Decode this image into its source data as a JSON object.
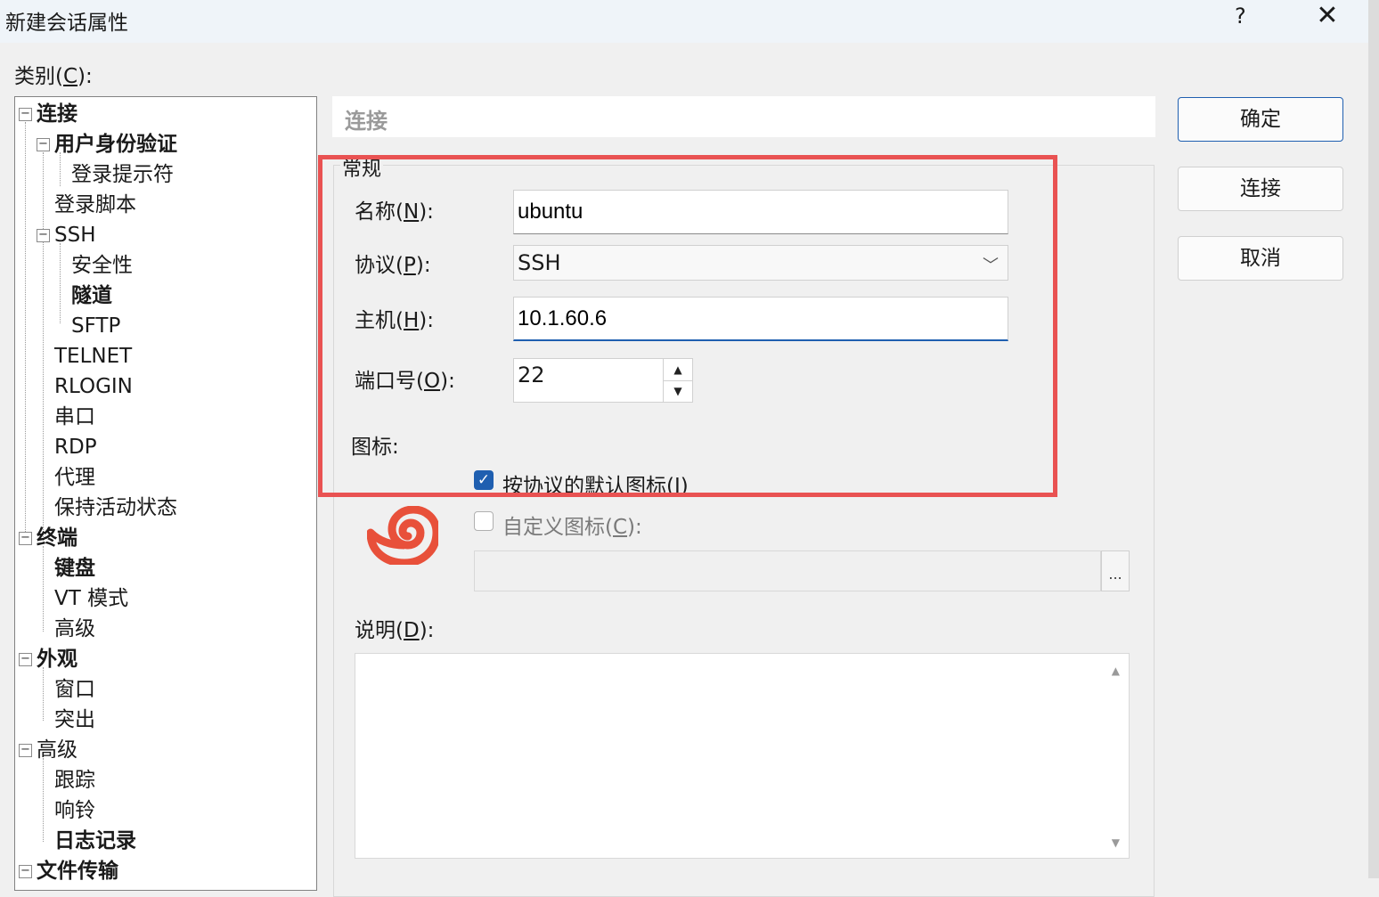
{
  "window": {
    "title": "新建会话属性",
    "help_label": "?",
    "close_label": "✕"
  },
  "category": {
    "label_prefix": "类别(",
    "label_hotkey": "C",
    "label_suffix": "):"
  },
  "tree": {
    "items": [
      {
        "label": "连接",
        "bold": true
      },
      {
        "label": "用户身份验证",
        "bold": true
      },
      {
        "label": "登录提示符",
        "bold": false
      },
      {
        "label": "登录脚本",
        "bold": false
      },
      {
        "label": "SSH",
        "bold": false
      },
      {
        "label": "安全性",
        "bold": false
      },
      {
        "label": "隧道",
        "bold": true
      },
      {
        "label": "SFTP",
        "bold": false
      },
      {
        "label": "TELNET",
        "bold": false
      },
      {
        "label": "RLOGIN",
        "bold": false
      },
      {
        "label": "串口",
        "bold": false
      },
      {
        "label": "RDP",
        "bold": false
      },
      {
        "label": "代理",
        "bold": false
      },
      {
        "label": "保持活动状态",
        "bold": false
      },
      {
        "label": "终端",
        "bold": true
      },
      {
        "label": "键盘",
        "bold": true
      },
      {
        "label": "VT 模式",
        "bold": false
      },
      {
        "label": "高级",
        "bold": false
      },
      {
        "label": "外观",
        "bold": true
      },
      {
        "label": "窗口",
        "bold": false
      },
      {
        "label": "突出",
        "bold": false
      },
      {
        "label": "高级",
        "bold": false
      },
      {
        "label": "跟踪",
        "bold": false
      },
      {
        "label": "响铃",
        "bold": false
      },
      {
        "label": "日志记录",
        "bold": true
      },
      {
        "label": "文件传输",
        "bold": true
      }
    ],
    "expander_symbol": "−"
  },
  "panel": {
    "header": "连接",
    "group_title": "常规"
  },
  "form": {
    "name_label_prefix": "名称(",
    "name_label_hotkey": "N",
    "name_label_suffix": "):",
    "name_value": "ubuntu",
    "protocol_label_prefix": "协议(",
    "protocol_label_hotkey": "P",
    "protocol_label_suffix": "):",
    "protocol_value": "SSH",
    "host_label_prefix": "主机(",
    "host_label_hotkey": "H",
    "host_label_suffix": "):",
    "host_value": "10.1.60.6",
    "port_label_prefix": "端口号(",
    "port_label_hotkey": "O",
    "port_label_suffix": "):",
    "port_value": "22",
    "icon_label": "图标:",
    "default_icon_label_prefix": "按协议的默认图标(",
    "default_icon_label_hotkey": "I",
    "default_icon_label_suffix": ")",
    "default_icon_checked": true,
    "custom_icon_label_prefix": "自定义图标(",
    "custom_icon_label_hotkey": "C",
    "custom_icon_label_suffix": "):",
    "custom_icon_checked": false,
    "browse_label": "...",
    "desc_label_prefix": "说明(",
    "desc_label_hotkey": "D",
    "desc_label_suffix": "):"
  },
  "buttons": {
    "ok": "确定",
    "connect": "连接",
    "cancel": "取消"
  },
  "icons": {
    "chevron": "﹀",
    "spin_up": "▲",
    "spin_down": "▼",
    "check": "✓",
    "scroll_up": "▲",
    "scroll_down": "▼"
  },
  "colors": {
    "accent": "#1f5fb0",
    "highlight": "#e95252",
    "logo": "#e8503a"
  }
}
